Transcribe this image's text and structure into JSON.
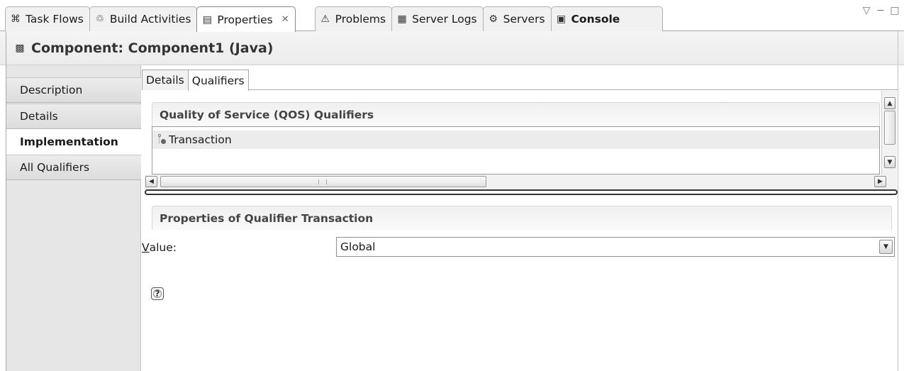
{
  "view_tabs": [
    {
      "label": "Task Flows",
      "icon": "task-flows-icon",
      "glyph": "⌘"
    },
    {
      "label": "Build Activities",
      "icon": "build-activities-icon",
      "glyph": "♲"
    },
    {
      "label": "Properties",
      "icon": "properties-icon",
      "glyph": "▤",
      "active": true,
      "close": "✕"
    },
    {
      "label": "Problems",
      "icon": "problems-icon",
      "glyph": "⚠"
    },
    {
      "label": "Server Logs",
      "icon": "server-logs-icon",
      "glyph": "▦"
    },
    {
      "label": "Servers",
      "icon": "servers-icon",
      "glyph": "⚙"
    },
    {
      "label": "Console",
      "icon": "console-icon",
      "glyph": "▣",
      "bold": true
    }
  ],
  "view_controls": {
    "menu": "▽",
    "minimize": "−",
    "maximize": "□"
  },
  "header": {
    "title": "Component: Component1 (Java)",
    "icon": "component-icon",
    "glyph": "▩"
  },
  "nav": {
    "items": [
      "Description",
      "Details",
      "Implementation",
      "All Qualifiers"
    ],
    "active": "Implementation"
  },
  "subtabs": {
    "items": [
      "Details",
      "Qualifiers"
    ],
    "active": "Qualifiers"
  },
  "qos": {
    "title": "Quality of Service (QOS) Qualifiers",
    "items": [
      "Transaction"
    ]
  },
  "properties": {
    "title": "Properties of Qualifier Transaction",
    "value_label_mnemonic": "V",
    "value_label_rest": "alue:",
    "value": "Global"
  },
  "help": {
    "glyph": "?"
  },
  "scroll": {
    "up": "▲",
    "down": "▼",
    "left": "◀",
    "right": "▶",
    "drop": "▼"
  }
}
